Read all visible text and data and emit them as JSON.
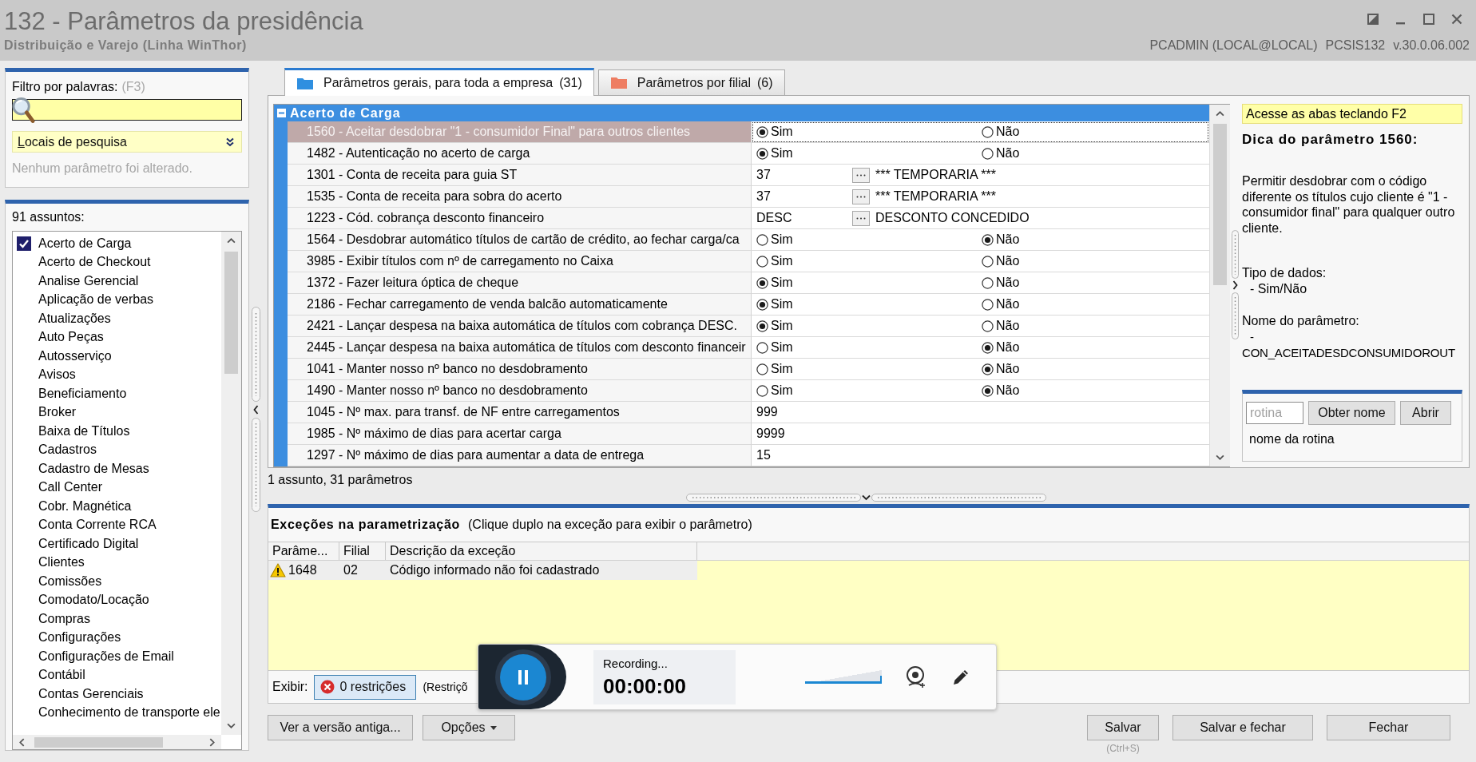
{
  "window": {
    "title": "132 - Parâmetros da presidência",
    "subtitle": "Distribuição e Varejo (Linha WinThor)",
    "info": [
      "PCADMIN (LOCAL@LOCAL)",
      "PCSIS132",
      "v.30.0.06.002"
    ]
  },
  "filter": {
    "label": "Filtro por palavras:",
    "shortcut": "(F3)",
    "locations": "Locais de pesquisa",
    "status": "Nenhum parâmetro foi alterado."
  },
  "subjects": {
    "count_label": "91 assuntos:",
    "items": [
      {
        "label": "Acerto de Carga",
        "checked": true
      },
      {
        "label": "Acerto de Checkout",
        "checked": false
      },
      {
        "label": "Analise Gerencial",
        "checked": false
      },
      {
        "label": "Aplicação de verbas",
        "checked": false
      },
      {
        "label": "Atualizações",
        "checked": false
      },
      {
        "label": "Auto Peças",
        "checked": false
      },
      {
        "label": "Autosserviço",
        "checked": false
      },
      {
        "label": "Avisos",
        "checked": false
      },
      {
        "label": "Beneficiamento",
        "checked": false
      },
      {
        "label": "Broker",
        "checked": false
      },
      {
        "label": "Baixa de Títulos",
        "checked": false
      },
      {
        "label": "Cadastros",
        "checked": false
      },
      {
        "label": "Cadastro de Mesas",
        "checked": false
      },
      {
        "label": "Call Center",
        "checked": false
      },
      {
        "label": "Cobr. Magnética",
        "checked": false
      },
      {
        "label": "Conta Corrente RCA",
        "checked": false
      },
      {
        "label": "Certificado Digital",
        "checked": false
      },
      {
        "label": "Clientes",
        "checked": false
      },
      {
        "label": "Comissões",
        "checked": false
      },
      {
        "label": "Comodato/Locação",
        "checked": false
      },
      {
        "label": "Compras",
        "checked": false
      },
      {
        "label": "Configurações",
        "checked": false
      },
      {
        "label": "Configurações de Email",
        "checked": false
      },
      {
        "label": "Contábil",
        "checked": false
      },
      {
        "label": "Contas Gerenciais",
        "checked": false
      },
      {
        "label": "Conhecimento de transporte ele",
        "checked": false
      }
    ]
  },
  "tabs": [
    {
      "label": "Parâmetros gerais, para toda a empresa",
      "count": "(31)",
      "selected": true,
      "color": "#2f8fe0"
    },
    {
      "label": "Parâmetros por filial",
      "count": "(6)",
      "selected": false,
      "color": "#ee7d62"
    }
  ],
  "parameters": {
    "group": "Acerto de Carga",
    "expanded": true,
    "rows": [
      {
        "kind": "radio",
        "label": "1560 - Aceitar desdobrar \"1 - consumidor Final\" para outros clientes",
        "selected": true,
        "options": [
          {
            "label": "Sim",
            "selected": true
          },
          {
            "label": "Não",
            "selected": false
          }
        ]
      },
      {
        "kind": "radio",
        "label": "1482 - Autenticação no acerto de carga",
        "selected": false,
        "options": [
          {
            "label": "Sim",
            "selected": true
          },
          {
            "label": "Não",
            "selected": false
          }
        ]
      },
      {
        "kind": "lookup",
        "label": "1301 - Conta de receita para guia ST",
        "selected": false,
        "value": "37",
        "description": "*** TEMPORARIA ***"
      },
      {
        "kind": "lookup",
        "label": "1535 - Conta de receita para sobra do acerto",
        "selected": false,
        "value": "37",
        "description": "*** TEMPORARIA ***"
      },
      {
        "kind": "lookup",
        "label": "1223 - Cód. cobrança desconto financeiro",
        "selected": false,
        "value": "DESC",
        "description": "DESCONTO CONCEDIDO"
      },
      {
        "kind": "radio",
        "label": "1564 - Desdobrar automático títulos de cartão de crédito, ao fechar carga/ca",
        "selected": false,
        "options": [
          {
            "label": "Sim",
            "selected": false
          },
          {
            "label": "Não",
            "selected": true
          }
        ]
      },
      {
        "kind": "radio",
        "label": "3985 - Exibir títulos com nº de carregamento no Caixa",
        "selected": false,
        "options": [
          {
            "label": "Sim",
            "selected": false
          },
          {
            "label": "Não",
            "selected": false
          }
        ]
      },
      {
        "kind": "radio",
        "label": "1372 - Fazer leitura óptica de cheque",
        "selected": false,
        "options": [
          {
            "label": "Sim",
            "selected": true
          },
          {
            "label": "Não",
            "selected": false
          }
        ]
      },
      {
        "kind": "radio",
        "label": "2186 - Fechar carregamento de venda balcão automaticamente",
        "selected": false,
        "options": [
          {
            "label": "Sim",
            "selected": true
          },
          {
            "label": "Não",
            "selected": false
          }
        ]
      },
      {
        "kind": "radio",
        "label": "2421 - Lançar despesa na baixa automática de títulos com cobrança DESC.",
        "selected": false,
        "options": [
          {
            "label": "Sim",
            "selected": true
          },
          {
            "label": "Não",
            "selected": false
          }
        ]
      },
      {
        "kind": "radio",
        "label": "2445 - Lançar despesa na baixa automática de títulos com desconto financeir",
        "selected": false,
        "options": [
          {
            "label": "Sim",
            "selected": false
          },
          {
            "label": "Não",
            "selected": true
          }
        ]
      },
      {
        "kind": "radio",
        "label": "1041 - Manter nosso nº banco no desdobramento",
        "selected": false,
        "options": [
          {
            "label": "Sim",
            "selected": false
          },
          {
            "label": "Não",
            "selected": true
          }
        ]
      },
      {
        "kind": "radio",
        "label": "1490 - Manter nosso nº banco no desdobramento",
        "selected": false,
        "options": [
          {
            "label": "Sim",
            "selected": false
          },
          {
            "label": "Não",
            "selected": true
          }
        ]
      },
      {
        "kind": "number",
        "label": "1045 - Nº max. para transf. de NF entre carregamentos",
        "selected": false,
        "value": "999"
      },
      {
        "kind": "number",
        "label": "1985 - Nº máximo de dias para acertar carga",
        "selected": false,
        "value": "9999"
      },
      {
        "kind": "number",
        "label": "1297 - Nº máximo de dias para aumentar a data de entrega",
        "selected": false,
        "value": "15"
      }
    ]
  },
  "summary": "1 assunto, 31 parâmetros",
  "tip": {
    "hint": "Acesse as abas teclando F2",
    "title": "Dica do parâmetro 1560:",
    "text": "Permitir desdobrar com o código diferente os títulos cujo cliente é \"1 - consumidor final\" para qualquer outro cliente.",
    "data_type_label": "Tipo de dados:",
    "data_type": "- Sim/Não",
    "name_label": "Nome do parâmetro:",
    "name_lines": [
      "-",
      "CON_ACEITADESDCONSUMIDOROUT"
    ]
  },
  "routine": {
    "placeholder": "rotina",
    "buttons": [
      "Obter nome",
      "Abrir"
    ],
    "name": "nome da rotina"
  },
  "exceptions": {
    "title": "Exceções na parametrização",
    "hint": "(Clique duplo na exceção para exibir o parâmetro)",
    "columns": [
      "Parâme...",
      "Filial",
      "Descrição da exceção"
    ],
    "rows": [
      {
        "kind": "warning",
        "cells": [
          "1648",
          "02",
          "Código informado não foi cadastrado"
        ]
      }
    ],
    "show_label": "Exibir:",
    "filter_button": "0 restrições",
    "filter_note": "(Restriçõ"
  },
  "recorder": {
    "status": "Recording...",
    "time": "00:00:00",
    "volume": {
      "level": 1
    }
  },
  "footer": {
    "left": [
      {
        "label": "Ver a versão antiga...",
        "kind": "plain"
      },
      {
        "label": "Opções",
        "kind": "menu"
      }
    ],
    "right": [
      {
        "label": "Salvar",
        "shortcut": "(Ctrl+S)"
      },
      {
        "label": "Salvar e fechar"
      },
      {
        "label": "Fechar"
      }
    ]
  }
}
